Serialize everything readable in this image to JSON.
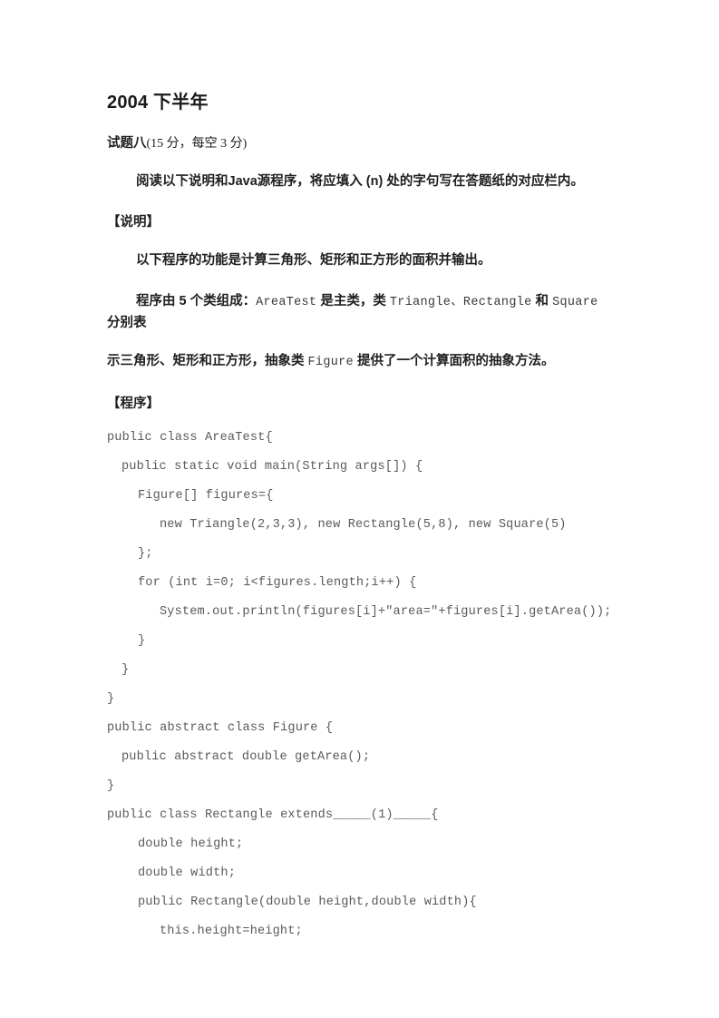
{
  "document": {
    "title": "2004 下半年",
    "question_header": {
      "label": "试题八",
      "score_note": "(15 分，每空 3 分)"
    },
    "instruction": "阅读以下说明和Java源程序，将应填入 (n)  处的字句写在答题纸的对应栏内。",
    "sections": [
      {
        "tag": "【说明】",
        "paragraphs": [
          "以下程序的功能是计算三角形、矩形和正方形的面积并输出。",
          "程序由 5 个类组成：AreaTest 是主类，类 Triangle、Rectangle 和 Square 分别表",
          "示三角形、矩形和正方形，抽象类 Figure 提供了一个计算面积的抽象方法。"
        ],
        "desc_line_2_parts": {
          "before": "程序由 5 个类组成：",
          "mono_1": "AreaTest",
          "mid_1": " 是主类，类 ",
          "mono_2": "Triangle、Rectangle",
          "mid_2": " 和 ",
          "mono_3": "Square",
          "after": " 分别表"
        },
        "desc_line_3_parts": {
          "before": "示三角形、矩形和正方形，抽象类 ",
          "mono_1": "Figure",
          "after": " 提供了一个计算面积的抽象方法。"
        }
      },
      {
        "tag": "【程序】"
      }
    ],
    "code_lines": [
      {
        "indent": 0,
        "text": "public class AreaTest{"
      },
      {
        "indent": 1,
        "text": "public static void main(String args[]) {"
      },
      {
        "indent": 2,
        "text": "Figure[] figures={"
      },
      {
        "indent": 3,
        "text": "new Triangle(2,3,3), new Rectangle(5,8), new Square(5)"
      },
      {
        "indent": 2,
        "text": "};"
      },
      {
        "indent": 2,
        "text": "for (int i=0; i<figures.length;i++) {"
      },
      {
        "indent": 3,
        "text": "System.out.println(figures[i]+\"area=\"+figures[i].getArea());"
      },
      {
        "indent": 2,
        "text": "}"
      },
      {
        "indent": 1,
        "text": "}"
      },
      {
        "indent": 0,
        "text": "}"
      },
      {
        "indent": 0,
        "text": "public abstract class Figure {"
      },
      {
        "indent": 1,
        "text": "public abstract double getArea();"
      },
      {
        "indent": 0,
        "text": "}"
      },
      {
        "indent": 0,
        "text": "public class Rectangle extends_____(1)_____{"
      },
      {
        "indent": 2,
        "text": "double height;"
      },
      {
        "indent": 2,
        "text": "double width;"
      },
      {
        "indent": 2,
        "text": "public Rectangle(double height,double width){"
      },
      {
        "indent": 3,
        "text": "this.height=height;"
      }
    ]
  }
}
